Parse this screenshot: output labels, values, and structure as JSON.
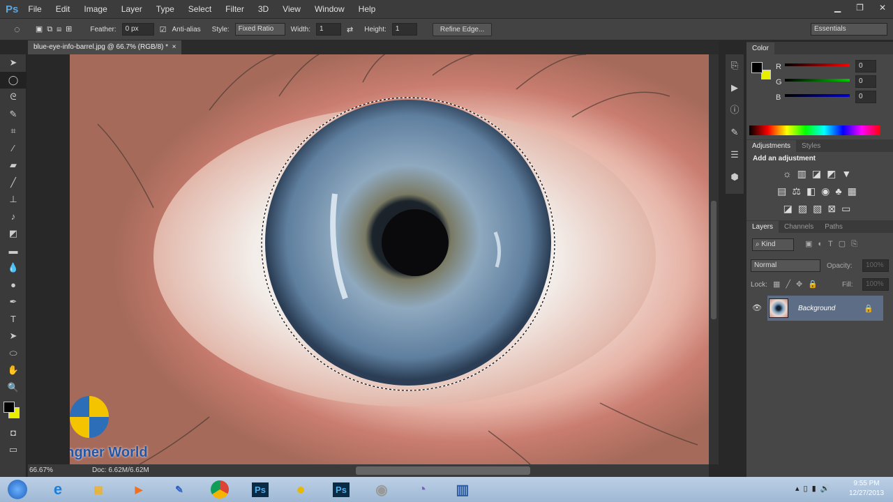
{
  "app": {
    "logo": "Ps",
    "menu": [
      "File",
      "Edit",
      "Image",
      "Layer",
      "Type",
      "Select",
      "Filter",
      "3D",
      "View",
      "Window",
      "Help"
    ]
  },
  "options": {
    "feather_label": "Feather:",
    "feather_value": "0 px",
    "antialias_label": "Anti-alias",
    "style_label": "Style:",
    "style_value": "Fixed Ratio",
    "width_label": "Width:",
    "width_value": "1",
    "height_label": "Height:",
    "height_value": "1",
    "refine_edge": "Refine Edge...",
    "workspace": "Essentials"
  },
  "document": {
    "tab_title": "blue-eye-info-barrel.jpg @ 66.7% (RGB/8) *",
    "zoom": "66.67%",
    "doc_size": "Doc: 6.62M/6.62M",
    "watermark": "Desingner World"
  },
  "color_panel": {
    "title": "Color",
    "r": "0",
    "g": "0",
    "b": "0",
    "r_label": "R",
    "g_label": "G",
    "b_label": "B",
    "fg": "#000000",
    "bg": "#e8f000"
  },
  "adjustments": {
    "tabs": [
      "Adjustments",
      "Styles"
    ],
    "heading": "Add an adjustment"
  },
  "layers": {
    "tabs": [
      "Layers",
      "Channels",
      "Paths"
    ],
    "kind": "Kind",
    "blend": "Normal",
    "opacity_label": "Opacity:",
    "opacity": "100%",
    "lock_label": "Lock:",
    "fill_label": "Fill:",
    "fill": "100%",
    "items": [
      {
        "name": "Background"
      }
    ]
  },
  "taskbar": {
    "time": "9:55 PM",
    "date": "12/27/2013"
  }
}
